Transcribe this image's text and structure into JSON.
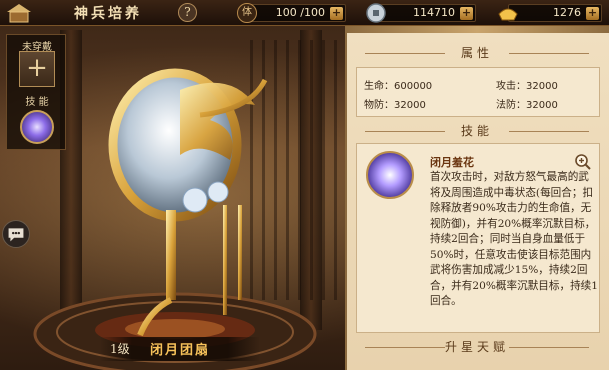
{
  "header": {
    "title": "神兵培养",
    "help_label": "?"
  },
  "resources": {
    "stamina_label": "体",
    "stamina_value": "100 /100",
    "silver_value": "114710",
    "gold_value": "1276"
  },
  "equip_panel": {
    "slot_label": "未穿戴",
    "skill_label": "技 能",
    "add_glyph": "+"
  },
  "weapon": {
    "level": "1级",
    "name": "闭月团扇"
  },
  "attributes": {
    "header": "属性",
    "items": [
      {
        "label": "生命：",
        "value": "600000"
      },
      {
        "label": "攻击：",
        "value": "32000"
      },
      {
        "label": "物防：",
        "value": "32000"
      },
      {
        "label": "法防：",
        "value": "32000"
      }
    ]
  },
  "skill": {
    "header": "技能",
    "name": "闭月羞花",
    "description": "首次攻击时，对敌方怒气最高的武将及周围造成中毒状态(每回合；扣除释放者90%攻击力的生命值，无视防御)，并有20%概率沉默目标，持续2回合；同时当自身血量低于50%时，任意攻击使该目标范围内武将伤害加成减少15%，持续2回合，并有20%概率沉默目标，持续1回合。"
  },
  "talent": {
    "header": "升星天赋"
  },
  "colors": {
    "accent_gold": "#f7c25a",
    "panel_bg": "#f0dfc0",
    "text_dark": "#3a2a1a"
  }
}
